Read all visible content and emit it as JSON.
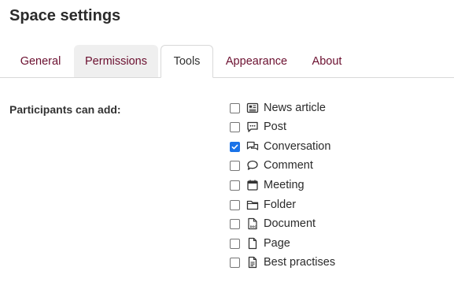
{
  "page": {
    "title": "Space settings"
  },
  "tabs": [
    {
      "label": "General"
    },
    {
      "label": "Permissions"
    },
    {
      "label": "Tools"
    },
    {
      "label": "Appearance"
    },
    {
      "label": "About"
    }
  ],
  "tools": {
    "field_label": "Participants can add:",
    "options": [
      {
        "label": "News article",
        "icon": "newspaper-icon",
        "checked": false
      },
      {
        "label": "Post",
        "icon": "speech-bubble-dots-icon",
        "checked": false
      },
      {
        "label": "Conversation",
        "icon": "conversation-bubbles-icon",
        "checked": true
      },
      {
        "label": "Comment",
        "icon": "comment-bubble-icon",
        "checked": false
      },
      {
        "label": "Meeting",
        "icon": "calendar-icon",
        "checked": false
      },
      {
        "label": "Folder",
        "icon": "folder-icon",
        "checked": false
      },
      {
        "label": "Document",
        "icon": "document-doc-icon",
        "checked": false
      },
      {
        "label": "Page",
        "icon": "page-icon",
        "checked": false
      },
      {
        "label": "Best practises",
        "icon": "document-text-icon",
        "checked": false
      }
    ]
  },
  "colors": {
    "tab_text": "#6b0f2f",
    "checkbox_checked": "#1a73e8"
  }
}
